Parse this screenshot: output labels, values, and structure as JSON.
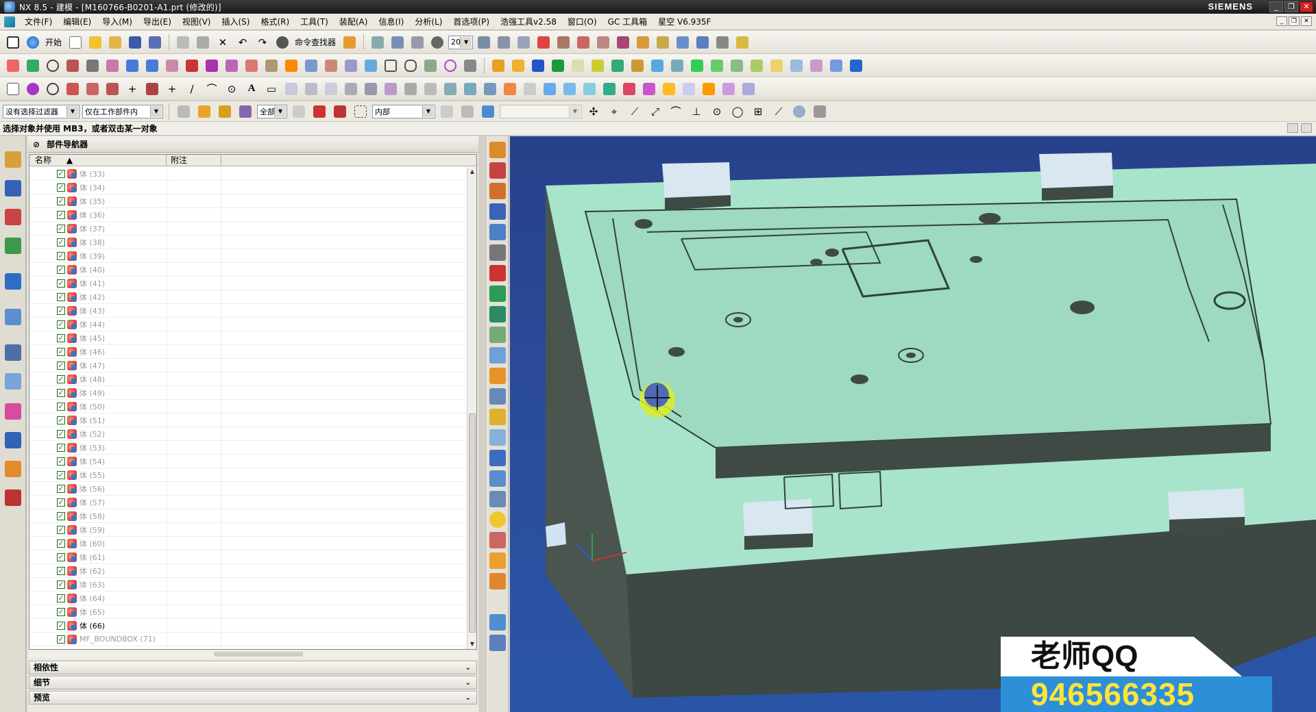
{
  "window": {
    "title": "NX 8.5 - 建模 - [M160766-B0201-A1.prt (修改的)]",
    "brand": "SIEMENS"
  },
  "menu": [
    "文件(F)",
    "编辑(E)",
    "导入(M)",
    "导出(E)",
    "视图(V)",
    "插入(S)",
    "格式(R)",
    "工具(T)",
    "装配(A)",
    "信息(I)",
    "分析(L)",
    "首选项(P)",
    "浩强工具v2.58",
    "窗口(O)",
    "GC 工具箱",
    "星空 V6.935F"
  ],
  "toolbar": {
    "start_label": "开始",
    "command_finder_label": "命令查找器",
    "zoom_value": "20"
  },
  "filter": {
    "type_filter": "没有选择过滤器",
    "scope": "仅在工作部件内",
    "all_label": "全部",
    "mode": "内部"
  },
  "cue": "选择对象并使用 MB3，或者双击某一对象",
  "navigator": {
    "title": "部件导航器",
    "col_name": "名称",
    "col_note": "附注",
    "rows": [
      {
        "label": "体 (33)"
      },
      {
        "label": "体 (34)"
      },
      {
        "label": "体 (35)"
      },
      {
        "label": "体 (36)"
      },
      {
        "label": "体 (37)"
      },
      {
        "label": "体 (38)"
      },
      {
        "label": "体 (39)"
      },
      {
        "label": "体 (40)"
      },
      {
        "label": "体 (41)"
      },
      {
        "label": "体 (42)"
      },
      {
        "label": "体 (43)"
      },
      {
        "label": "体 (44)"
      },
      {
        "label": "体 (45)"
      },
      {
        "label": "体 (46)"
      },
      {
        "label": "体 (47)"
      },
      {
        "label": "体 (48)"
      },
      {
        "label": "体 (49)"
      },
      {
        "label": "体 (50)"
      },
      {
        "label": "体 (51)"
      },
      {
        "label": "体 (52)"
      },
      {
        "label": "体 (53)"
      },
      {
        "label": "体 (54)"
      },
      {
        "label": "体 (55)"
      },
      {
        "label": "体 (56)"
      },
      {
        "label": "体 (57)"
      },
      {
        "label": "体 (58)"
      },
      {
        "label": "体 (59)"
      },
      {
        "label": "体 (60)"
      },
      {
        "label": "体 (61)"
      },
      {
        "label": "体 (62)"
      },
      {
        "label": "体 (63)"
      },
      {
        "label": "体 (64)"
      },
      {
        "label": "体 (65)"
      },
      {
        "label": "体 (66)",
        "active": true
      },
      {
        "label": "MF_BOUNDBOX (71)"
      }
    ],
    "panels": [
      "相依性",
      "细节",
      "预览"
    ]
  },
  "watermark": {
    "line1": "老师QQ",
    "line2": "946566335"
  },
  "colors": {
    "model_face": "#a8e6cc",
    "model_side": "#3f4a44",
    "viewport_bg": "#2a4c9c"
  }
}
